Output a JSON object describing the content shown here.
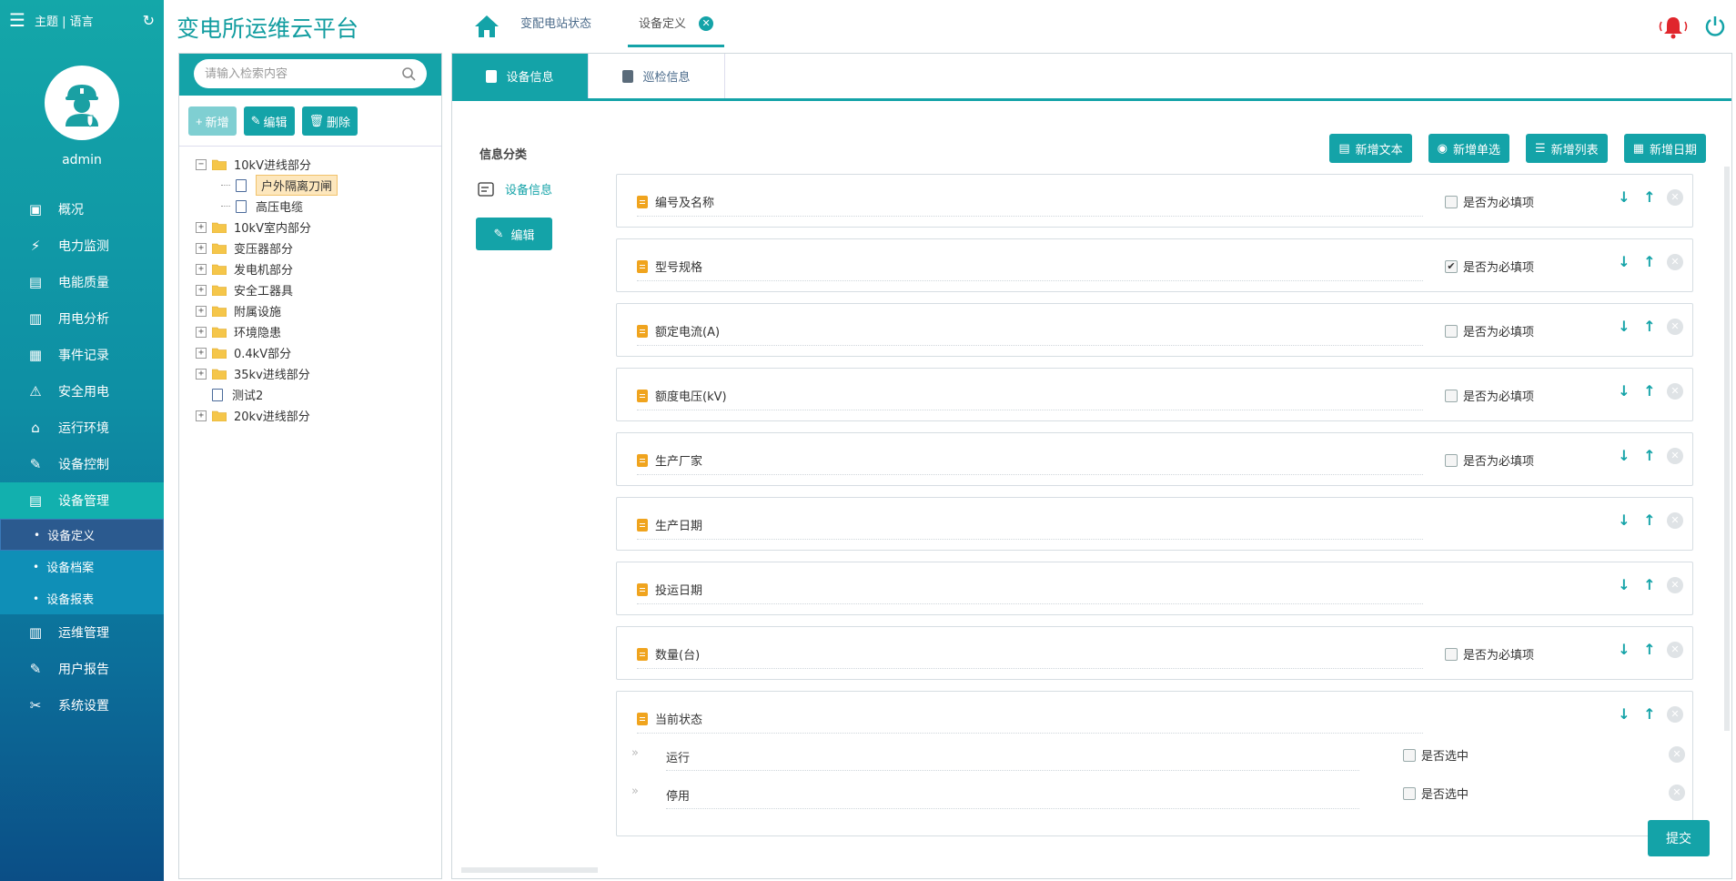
{
  "nav": {
    "theme_lang": "主题 | 语言",
    "username": "admin",
    "items": [
      {
        "label": "概况",
        "icon": "monitor-icon"
      },
      {
        "label": "电力监测",
        "icon": "power-monitor-icon"
      },
      {
        "label": "电能质量",
        "icon": "quality-icon"
      },
      {
        "label": "用电分析",
        "icon": "chart-icon"
      },
      {
        "label": "事件记录",
        "icon": "record-icon"
      },
      {
        "label": "安全用电",
        "icon": "alarm-icon"
      },
      {
        "label": "运行环境",
        "icon": "camera-icon"
      },
      {
        "label": "设备控制",
        "icon": "control-icon"
      },
      {
        "label": "设备管理",
        "icon": "device-icon"
      }
    ],
    "sub_items": [
      "设备定义",
      "设备档案",
      "设备报表"
    ],
    "items_after": [
      {
        "label": "运维管理",
        "icon": "ops-icon"
      },
      {
        "label": "用户报告",
        "icon": "report-icon"
      },
      {
        "label": "系统设置",
        "icon": "settings-icon"
      }
    ]
  },
  "header": {
    "platform_title": "变电所运维云平台",
    "tab_status": "变配电站状态",
    "tab_define": "设备定义"
  },
  "tree": {
    "search_placeholder": "请输入检索内容",
    "btn_add": "新增",
    "btn_edit": "编辑",
    "btn_delete": "删除",
    "nodes": [
      {
        "label": "10kV进线部分",
        "type": "folder",
        "expanded": true
      },
      {
        "label": "户外隔离刀闸",
        "type": "doc",
        "child": true,
        "selected": true
      },
      {
        "label": "高压电缆",
        "type": "doc",
        "child": true
      },
      {
        "label": "10kV室内部分",
        "type": "folder"
      },
      {
        "label": "变压器部分",
        "type": "folder"
      },
      {
        "label": "发电机部分",
        "type": "folder"
      },
      {
        "label": "安全工器具",
        "type": "folder"
      },
      {
        "label": "附属设施",
        "type": "folder"
      },
      {
        "label": "环境隐患",
        "type": "folder"
      },
      {
        "label": "0.4kV部分",
        "type": "folder"
      },
      {
        "label": "35kv进线部分",
        "type": "folder"
      },
      {
        "label": "测试2",
        "type": "doc"
      },
      {
        "label": "20kv进线部分",
        "type": "folder"
      }
    ]
  },
  "main": {
    "tab_device_info": "设备信息",
    "tab_patrol_info": "巡检信息",
    "category_title": "信息分类",
    "category_item": "设备信息",
    "category_edit": "编辑",
    "add_text": "新增文本",
    "add_radio": "新增单选",
    "add_list": "新增列表",
    "add_date": "新增日期",
    "required_label": "是否为必填项",
    "selected_label": "是否选中",
    "submit": "提交",
    "fields": [
      {
        "name": "编号及名称",
        "required_shown": true,
        "checked": false
      },
      {
        "name": "型号规格",
        "required_shown": true,
        "checked": true
      },
      {
        "name": "额定电流(A)",
        "required_shown": true,
        "checked": false
      },
      {
        "name": "额度电压(kV)",
        "required_shown": true,
        "checked": false
      },
      {
        "name": "生产厂家",
        "required_shown": true,
        "checked": false
      },
      {
        "name": "生产日期",
        "required_shown": false,
        "checked": false
      },
      {
        "name": "投运日期",
        "required_shown": false,
        "checked": false
      },
      {
        "name": "数量(台)",
        "required_shown": true,
        "checked": false
      },
      {
        "name": "当前状态",
        "required_shown": false,
        "checked": false
      }
    ],
    "status_options": [
      "运行",
      "停用"
    ]
  },
  "colors": {
    "accent": "#14a3a8",
    "nav_top": "#14a7a9",
    "nav_bottom": "#0b4e86",
    "bell": "#e0262c",
    "clip": "#f0a41e"
  }
}
